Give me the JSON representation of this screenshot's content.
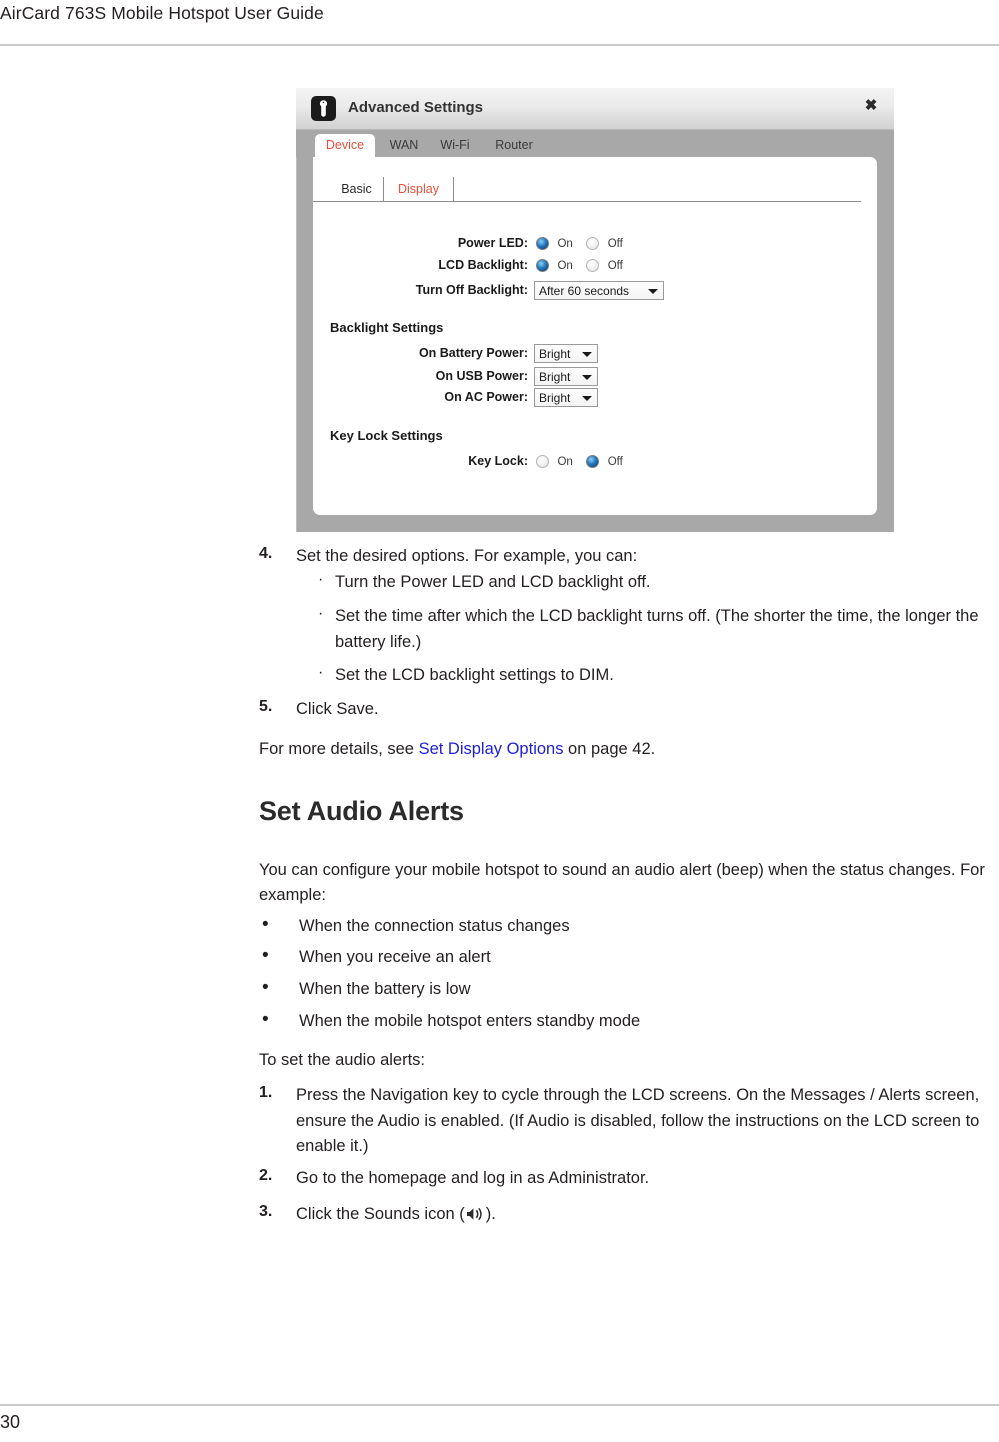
{
  "page": {
    "running_header": "AirCard 763S Mobile Hotspot User Guide",
    "page_number": "30"
  },
  "figure": {
    "dialog": {
      "title": "Advanced Settings",
      "icon": "wrench-icon",
      "close_label": "✖",
      "tabs": [
        {
          "label": "Device",
          "active": true
        },
        {
          "label": "WAN",
          "active": false
        },
        {
          "label": "Wi-Fi",
          "active": false
        },
        {
          "label": "Router",
          "active": false
        }
      ],
      "subtabs": [
        {
          "label": "Basic",
          "active": false
        },
        {
          "label": "Display",
          "active": true
        }
      ],
      "fields": [
        {
          "label": "Power LED:",
          "type": "radio",
          "value": "On",
          "options": [
            "On",
            "Off"
          ]
        },
        {
          "label": "LCD Backlight:",
          "type": "radio",
          "value": "On",
          "options": [
            "On",
            "Off"
          ]
        },
        {
          "label": "Turn Off Backlight:",
          "type": "select",
          "value": "After 60 seconds"
        }
      ],
      "groups": [
        {
          "heading": "Backlight Settings",
          "fields": [
            {
              "label": "On Battery Power:",
              "type": "select",
              "value": "Bright"
            },
            {
              "label": "On USB Power:",
              "type": "select",
              "value": "Bright"
            },
            {
              "label": "On AC Power:",
              "type": "select",
              "value": "Bright"
            }
          ]
        },
        {
          "heading": "Key Lock Settings",
          "fields": [
            {
              "label": "Key Lock:",
              "type": "radio",
              "value": "Off",
              "options": [
                "On",
                "Off"
              ]
            }
          ]
        }
      ],
      "accent_color": "#e8503a",
      "frame_color": "#a8a8a8"
    }
  },
  "content": {
    "step4": {
      "number": "4.",
      "text": "Set the desired options. For example, you can:",
      "subitems": [
        "Turn the Power LED and LCD backlight off.",
        "Set the time after which the LCD backlight turns off. (The shorter the time, the longer the battery life.)",
        "Set the LCD backlight settings to DIM."
      ],
      "bullet_glyph": "·"
    },
    "step5": {
      "number": "5.",
      "text": "Click Save."
    },
    "xref_paragraph": {
      "before": "For more details, see ",
      "link": "Set Display Options",
      "after": " on page 42.",
      "link_color": "#2020d8"
    },
    "section": {
      "heading": "Set Audio Alerts",
      "intro": "You can configure your mobile hotspot to sound an audio alert (beep) when the status changes. For example:",
      "bullets": [
        "When the connection status changes",
        "When you receive an alert",
        "When the battery is low",
        "When the mobile hotspot enters standby mode"
      ],
      "bullet_glyph": "•",
      "lead_in": "To set the audio alerts:",
      "steps": [
        {
          "number": "1.",
          "text": "Press the Navigation key to cycle through the LCD screens. On the Messages / Alerts screen, ensure the Audio is enabled. (If Audio is disabled, follow the instructions on the LCD screen to enable it.)"
        },
        {
          "number": "2.",
          "text": "Go to the homepage and log in as Administrator."
        },
        {
          "number": "3.",
          "text_before": "Click the Sounds icon (",
          "icon": "sounds-speaker-icon",
          "text_after": ")."
        }
      ]
    }
  }
}
